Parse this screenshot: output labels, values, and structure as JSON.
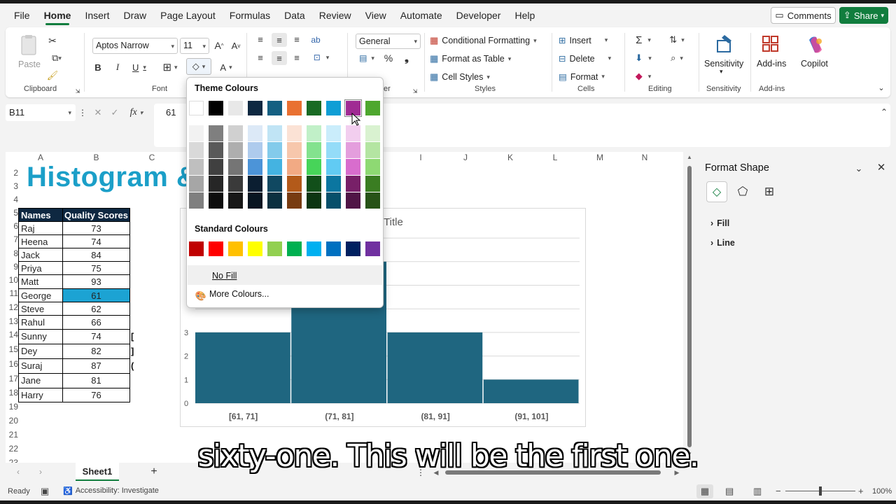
{
  "menu": {
    "items": [
      "File",
      "Home",
      "Insert",
      "Draw",
      "Page Layout",
      "Formulas",
      "Data",
      "Review",
      "View",
      "Automate",
      "Developer",
      "Help"
    ],
    "comments_label": "Comments",
    "share_label": "Share"
  },
  "ribbon": {
    "paste_label": "Paste",
    "clipboard_label": "Clipboard",
    "font_name": "Aptos Narrow",
    "font_size": "11",
    "font_label": "Font",
    "number_format": "General",
    "number_label_partial": "er",
    "conditional_formatting": "Conditional Formatting",
    "format_as_table": "Format as Table",
    "cell_styles": "Cell Styles",
    "styles_label": "Styles",
    "insert": "Insert",
    "delete": "Delete",
    "format": "Format",
    "cells_label": "Cells",
    "editing_label": "Editing",
    "sensitivity": "Sensitivity",
    "sensitivity_group": "Sensitivity",
    "addins": "Add-ins",
    "addins_group": "Add-ins",
    "copilot": "Copilot"
  },
  "formula_bar": {
    "cell_ref": "B11",
    "value": "61",
    "fx": "fx"
  },
  "columns": [
    "A",
    "B",
    "C",
    "I",
    "J",
    "K",
    "L",
    "M",
    "N"
  ],
  "rows": [
    "2",
    "3",
    "4",
    "5",
    "6",
    "7",
    "8",
    "9",
    "10",
    "11",
    "12",
    "13",
    "14",
    "15",
    "16",
    "17",
    "18",
    "19",
    "20",
    "21",
    "22",
    "23"
  ],
  "sheet_title": "Histogram &",
  "table": {
    "headers": [
      "Names",
      "Quality Scores"
    ],
    "rows": [
      [
        "Raj",
        "73"
      ],
      [
        "Heena",
        "74"
      ],
      [
        "Jack",
        "84"
      ],
      [
        "Priya",
        "75"
      ],
      [
        "Matt",
        "93"
      ],
      [
        "George",
        "61"
      ],
      [
        "Steve",
        "62"
      ],
      [
        "Rahul",
        "66"
      ],
      [
        "Sunny",
        "74"
      ],
      [
        "Dey",
        "82"
      ],
      [
        "Suraj",
        "87"
      ],
      [
        "Jane",
        "81"
      ],
      [
        "Harry",
        "76"
      ]
    ]
  },
  "col_c_fragments": [
    "[",
    "]",
    "("
  ],
  "chart_data": {
    "type": "bar",
    "title": "Chart Title",
    "visible_title_fragment": "t Title",
    "categories": [
      "[61, 71]",
      "(71, 81]",
      "(81, 91]",
      "(91, 101]"
    ],
    "values": [
      3,
      6,
      3,
      1
    ],
    "ylim": [
      0,
      7
    ],
    "yticks_visible": [
      "3",
      "2",
      "1",
      "0"
    ],
    "bar_color": "#1f6680",
    "grid": true
  },
  "color_popup": {
    "theme_title": "Theme Colours",
    "standard_title": "Standard Colours",
    "no_fill": "No Fill",
    "more_colours": "More Colours...",
    "theme_top": [
      "#ffffff",
      "#000000",
      "#e8e8e8",
      "#0e2841",
      "#156082",
      "#e97132",
      "#196b24",
      "#0f9ed5",
      "#a02b93",
      "#4ea72e"
    ],
    "theme_shades": [
      [
        "#f2f2f2",
        "#d9d9d9",
        "#bfbfbf",
        "#a6a6a6",
        "#7f7f7f"
      ],
      [
        "#7f7f7f",
        "#595959",
        "#404040",
        "#262626",
        "#0d0d0d"
      ],
      [
        "#d0d0d0",
        "#aeaeae",
        "#757575",
        "#3a3a3a",
        "#171717"
      ],
      [
        "#dce9f7",
        "#aecbed",
        "#4c94d8",
        "#0b1e31",
        "#081521"
      ],
      [
        "#c0e4f5",
        "#83cbeb",
        "#44b3e1",
        "#104861",
        "#0b3040"
      ],
      [
        "#fbe2d5",
        "#f7c7ac",
        "#f2aa84",
        "#b35a1a",
        "#783c11"
      ],
      [
        "#c1f0c8",
        "#83e28e",
        "#47d459",
        "#124f1a",
        "#0c3512"
      ],
      [
        "#caedfb",
        "#94dcf8",
        "#61cbf3",
        "#0b76a0",
        "#074f6a"
      ],
      [
        "#f2ceef",
        "#e49edd",
        "#d86dcd",
        "#782068",
        "#501546"
      ],
      [
        "#d9f2d0",
        "#b4e5a2",
        "#8ed973",
        "#3a7d22",
        "#275317"
      ]
    ],
    "standard": [
      "#c00000",
      "#ff0000",
      "#ffc000",
      "#ffff00",
      "#92d050",
      "#00b050",
      "#00b0f0",
      "#0070c0",
      "#002060",
      "#7030a0"
    ]
  },
  "panel": {
    "title": "Format Shape",
    "fill": "Fill",
    "line": "Line"
  },
  "sheet_tab": "Sheet1",
  "status": {
    "ready": "Ready",
    "accessibility": "Accessibility: Investigate",
    "zoom": "100%"
  },
  "caption": "sixty-one. This will be the first one."
}
